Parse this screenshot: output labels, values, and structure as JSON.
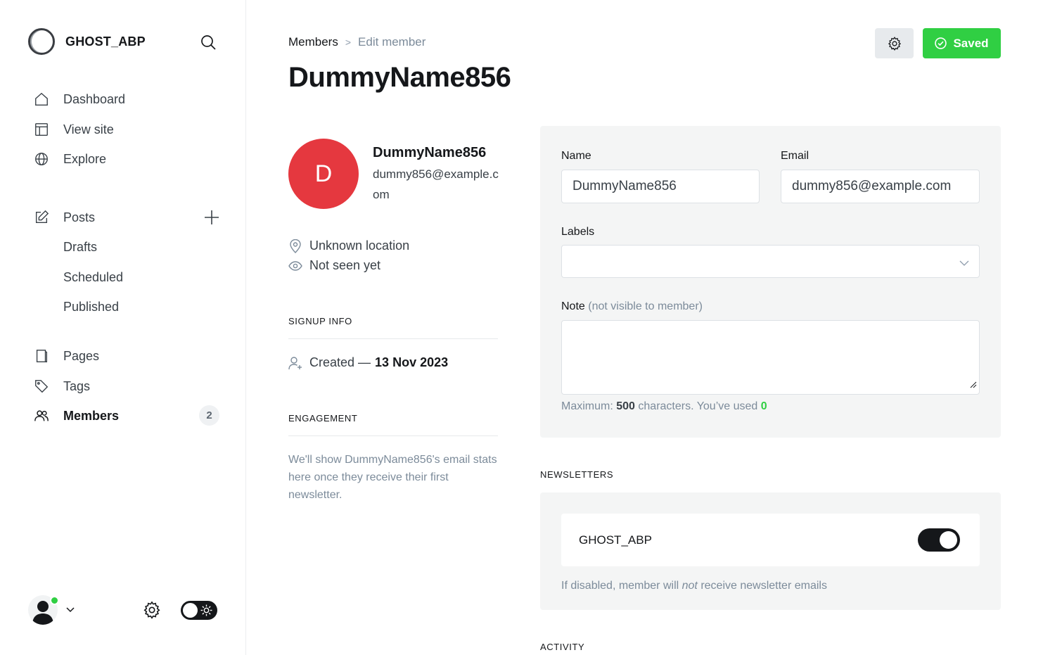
{
  "sidebar": {
    "brand_name": "GHOST_ABP",
    "nav": [
      {
        "label": "Dashboard",
        "icon": "home-icon"
      },
      {
        "label": "View site",
        "icon": "layout-icon"
      },
      {
        "label": "Explore",
        "icon": "globe-icon"
      }
    ],
    "posts": {
      "label": "Posts",
      "sub": [
        "Drafts",
        "Scheduled",
        "Published"
      ]
    },
    "pages_label": "Pages",
    "tags_label": "Tags",
    "members_label": "Members",
    "members_count": "2"
  },
  "header": {
    "breadcrumb_parent": "Members",
    "breadcrumb_sep": ">",
    "breadcrumb_current": "Edit member",
    "title": "DummyName856",
    "saved_label": "Saved"
  },
  "member": {
    "initial": "D",
    "name": "DummyName856",
    "email": "dummy856@example.com",
    "location": "Unknown location",
    "seen": "Not seen yet",
    "signup_head": "SIGNUP INFO",
    "created_prefix": "Created —",
    "created_date": "13 Nov 2023",
    "engagement_head": "ENGAGEMENT",
    "engagement_text": "We'll show DummyName856's email stats here once they receive their first newsletter."
  },
  "form": {
    "name_label": "Name",
    "name_value": "DummyName856",
    "email_label": "Email",
    "email_value": "dummy856@example.com",
    "labels_label": "Labels",
    "note_label": "Note",
    "note_muted": "(not visible to member)",
    "hint_prefix": "Maximum:",
    "hint_max": "500",
    "hint_mid": "characters. You’ve used",
    "hint_used": "0"
  },
  "newsletters": {
    "head": "NEWSLETTERS",
    "name": "GHOST_ABP",
    "enabled": true,
    "hint_a": "If disabled, member will",
    "hint_em": "not",
    "hint_b": "receive newsletter emails"
  },
  "activity_head": "ACTIVITY",
  "colors": {
    "accent_green": "#30cf43",
    "avatar_red": "#e5383f",
    "text_dark": "#15171a",
    "muted": "#7c8b9a"
  }
}
